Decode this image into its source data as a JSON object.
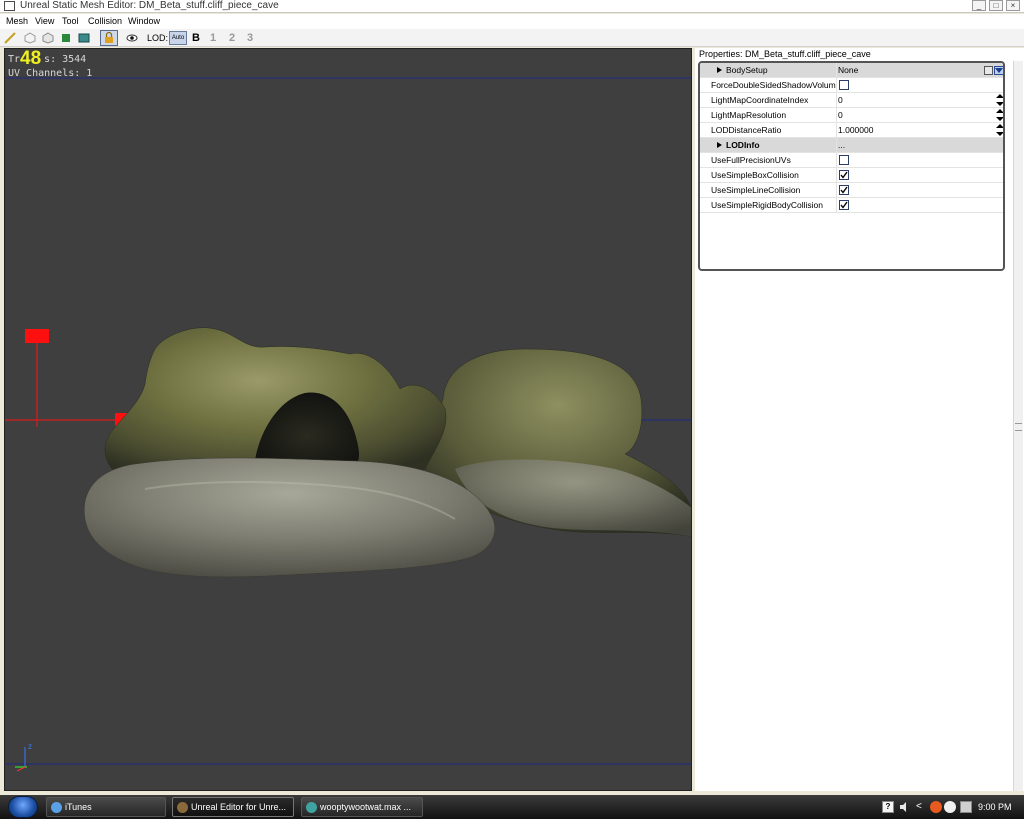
{
  "window": {
    "title": "Unreal Static Mesh Editor: DM_Beta_stuff.cliff_piece_cave",
    "minimize_glyph": "_",
    "maximize_glyph": "□",
    "close_glyph": "×"
  },
  "menu": {
    "items": [
      "Mesh",
      "View",
      "Tool",
      "Collision",
      "Window"
    ]
  },
  "toolbar": {
    "lod_label": "LOD:",
    "lod_auto": "Auto",
    "lod_base": "B",
    "lod_1": "1",
    "lod_2": "2",
    "lod_3": "3"
  },
  "viewport": {
    "fps_overlay": "48",
    "stats_triangles_label": "Tr",
    "stats_triangles_suffix": "s:",
    "stats_triangles_value": "3544",
    "stats_uv_label": "UV Channels:",
    "stats_uv_value": "1",
    "axis_z_label": "z"
  },
  "properties": {
    "title": "Properties: DM_Beta_stuff.cliff_piece_cave",
    "rows": [
      {
        "name": "BodySetup",
        "value": "None",
        "kind": "category"
      },
      {
        "name": "ForceDoubleSidedShadowVolume",
        "kind": "checkbox",
        "checked": false
      },
      {
        "name": "LightMapCoordinateIndex",
        "value": "0",
        "kind": "spinner"
      },
      {
        "name": "LightMapResolution",
        "value": "0",
        "kind": "spinner"
      },
      {
        "name": "LODDistanceRatio",
        "value": "1.000000",
        "kind": "spinner"
      },
      {
        "name": "LODInfo",
        "value": "...",
        "kind": "category-bold"
      },
      {
        "name": "UseFullPrecisionUVs",
        "kind": "checkbox",
        "checked": false
      },
      {
        "name": "UseSimpleBoxCollision",
        "kind": "checkbox",
        "checked": true
      },
      {
        "name": "UseSimpleLineCollision",
        "kind": "checkbox",
        "checked": true
      },
      {
        "name": "UseSimpleRigidBodyCollision",
        "kind": "checkbox",
        "checked": true
      }
    ]
  },
  "taskbar": {
    "tasks": [
      {
        "label": "iTunes",
        "icon": "itunes-icon",
        "color": "#5aa0e6"
      },
      {
        "label": "Unreal Editor for Unre...",
        "icon": "unreal-icon",
        "color": "#8a6a3a"
      },
      {
        "label": "wooptywootwat.max ...",
        "icon": "3dsmax-icon",
        "color": "#3fa3a0"
      }
    ],
    "clock": "9:00 PM",
    "chevron": "<"
  },
  "colors": {
    "viewport_bg": "#3f3f3f",
    "grid_line": "#1e2a8a",
    "pivot_red": "#ff1010",
    "fps_yellow": "#f0f020"
  }
}
